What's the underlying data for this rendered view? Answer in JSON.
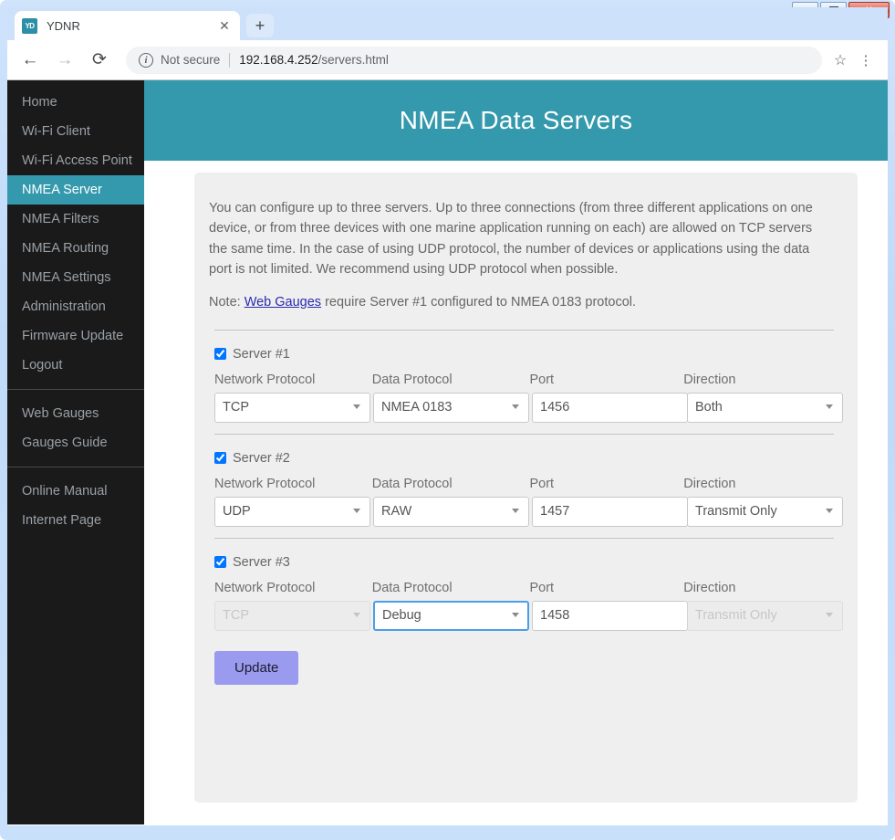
{
  "window": {
    "minimize_label": "Minimize",
    "maximize_label": "Maximize",
    "close_label": "✕"
  },
  "browser": {
    "tab": {
      "favicon_text": "YD",
      "title": "YDNR",
      "close_label": "✕"
    },
    "new_tab_label": "+",
    "nav": {
      "back_label": "←",
      "forward_label": "→",
      "reload_label": "⟳"
    },
    "omnibox": {
      "info_label": "i",
      "security_text": "Not secure",
      "url_host": "192.168.4.252",
      "url_path": "/servers.html"
    },
    "star_label": "☆",
    "menu_label": "⋮"
  },
  "sidebar": {
    "groups": [
      {
        "items": [
          {
            "label": "Home",
            "active": false
          },
          {
            "label": "Wi-Fi Client",
            "active": false
          },
          {
            "label": "Wi-Fi Access Point",
            "active": false
          },
          {
            "label": "NMEA Server",
            "active": true
          },
          {
            "label": "NMEA Filters",
            "active": false
          },
          {
            "label": "NMEA Routing",
            "active": false
          },
          {
            "label": "NMEA Settings",
            "active": false
          },
          {
            "label": "Administration",
            "active": false
          },
          {
            "label": "Firmware Update",
            "active": false
          },
          {
            "label": "Logout",
            "active": false
          }
        ]
      },
      {
        "items": [
          {
            "label": "Web Gauges",
            "active": false
          },
          {
            "label": "Gauges Guide",
            "active": false
          }
        ]
      },
      {
        "items": [
          {
            "label": "Online Manual",
            "active": false
          },
          {
            "label": "Internet Page",
            "active": false
          }
        ]
      }
    ]
  },
  "page": {
    "title": "NMEA Data Servers",
    "intro": "You can configure up to three servers. Up to three connections (from three different applications on one device, or from three devices with one marine application running on each) are allowed on TCP servers the same time. In the case of using UDP protocol, the number of devices or applications using the data port is not limited. We recommend using UDP protocol when possible.",
    "note_prefix": "Note: ",
    "note_link": "Web Gauges",
    "note_suffix": " require Server #1 configured to NMEA 0183 protocol.",
    "column_labels": {
      "network_protocol": "Network Protocol",
      "data_protocol": "Data Protocol",
      "port": "Port",
      "direction": "Direction"
    },
    "servers": [
      {
        "label": "Server #1",
        "enabled": true,
        "network_protocol": "TCP",
        "network_protocol_disabled": false,
        "data_protocol": "NMEA 0183",
        "data_protocol_focused": false,
        "port": "1456",
        "direction": "Both",
        "direction_disabled": false
      },
      {
        "label": "Server #2",
        "enabled": true,
        "network_protocol": "UDP",
        "network_protocol_disabled": false,
        "data_protocol": "RAW",
        "data_protocol_focused": false,
        "port": "1457",
        "direction": "Transmit Only",
        "direction_disabled": false
      },
      {
        "label": "Server #3",
        "enabled": true,
        "network_protocol": "TCP",
        "network_protocol_disabled": true,
        "data_protocol": "Debug",
        "data_protocol_focused": true,
        "port": "1458",
        "direction": "Transmit Only",
        "direction_disabled": true
      }
    ],
    "update_label": "Update"
  },
  "colors": {
    "accent_teal": "#3499ad",
    "sidebar_bg": "#1a1a1a",
    "panel_bg": "#efefef",
    "button_purple": "#9a9aee",
    "link_blue": "#2a2ab0"
  }
}
